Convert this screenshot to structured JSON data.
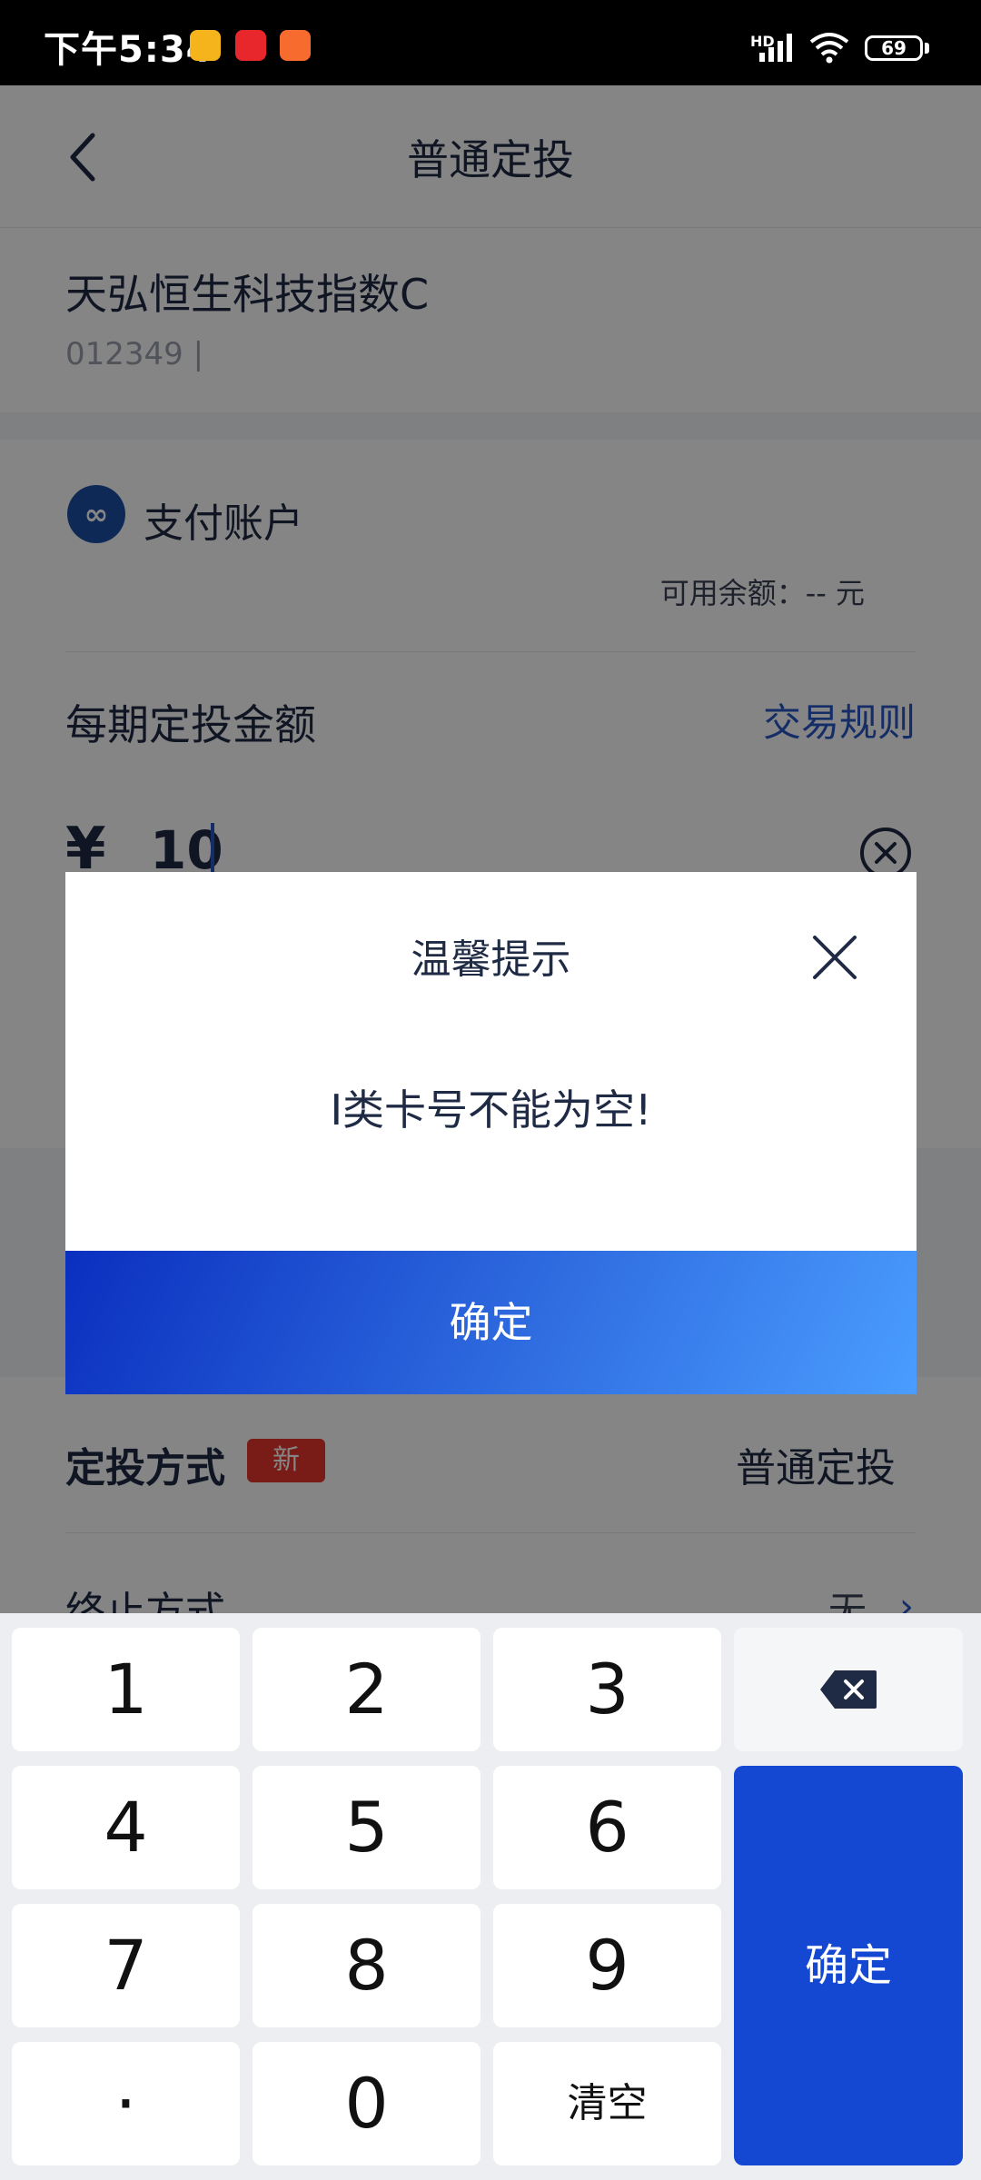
{
  "status_bar": {
    "time": "下午5:34",
    "network": "HD",
    "battery": "69"
  },
  "nav": {
    "title": "普通定投"
  },
  "fund": {
    "name": "天弘恒生科技指数C",
    "code": "012349 |"
  },
  "payment": {
    "account_label": "支付账户",
    "balance_text": "可用余额：-- 元"
  },
  "amount": {
    "label": "每期定投金额",
    "rules_link": "交易规则",
    "currency": "¥",
    "value": "10"
  },
  "method": {
    "label": "定投方式",
    "badge": "新",
    "value": "普通定投",
    "stop_label": "终止方式",
    "stop_value": "无"
  },
  "dialog": {
    "title": "温馨提示",
    "message": "I类卡号不能为空!",
    "confirm": "确定"
  },
  "keyboard": {
    "keys": [
      "1",
      "2",
      "3",
      "4",
      "5",
      "6",
      "7",
      "8",
      "9",
      "·",
      "0",
      "清空"
    ],
    "confirm": "确定"
  },
  "colors": {
    "accent": "#1447d2",
    "link": "#2a56c6",
    "badge": "#e8352c"
  }
}
